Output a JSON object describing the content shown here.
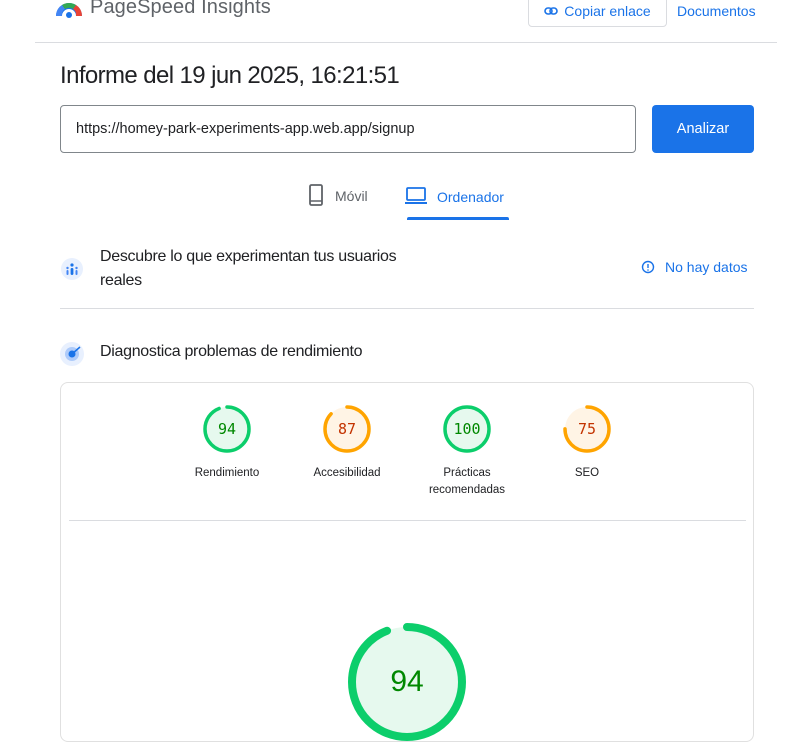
{
  "header": {
    "brand": "PageSpeed Insights",
    "copy_link_label": "Copiar enlace",
    "docs_label": "Documentos"
  },
  "report": {
    "title": "Informe del 19 jun 2025, 16:21:51"
  },
  "search": {
    "url_value": "https://homey-park-experiments-app.web.app/signup",
    "analyze_label": "Analizar"
  },
  "tabs": [
    {
      "label": "Móvil",
      "icon": "phone-icon",
      "active": false
    },
    {
      "label": "Ordenador",
      "icon": "laptop-icon",
      "active": true
    }
  ],
  "crux": {
    "title": "Descubre lo que experimentan tus usuarios reales",
    "status": "No hay datos"
  },
  "diagnostics": {
    "title": "Diagnostica problemas de rendimiento",
    "scores": [
      {
        "label": "Rendimiento",
        "score": 94,
        "status": "pass"
      },
      {
        "label": "Accesibilidad",
        "score": 87,
        "status": "average"
      },
      {
        "label": "Prácticas recomendadas",
        "score": 100,
        "status": "pass"
      },
      {
        "label": "SEO",
        "score": 75,
        "status": "average"
      }
    ],
    "main_score": 94
  },
  "colors": {
    "accent": "#1a73e8",
    "pass": "#0cce6b",
    "pass_text": "#008800",
    "pass_bg": "#e6f9ee",
    "average": "#ffa400",
    "average_text": "#c33300",
    "average_bg": "#fff4e5"
  }
}
